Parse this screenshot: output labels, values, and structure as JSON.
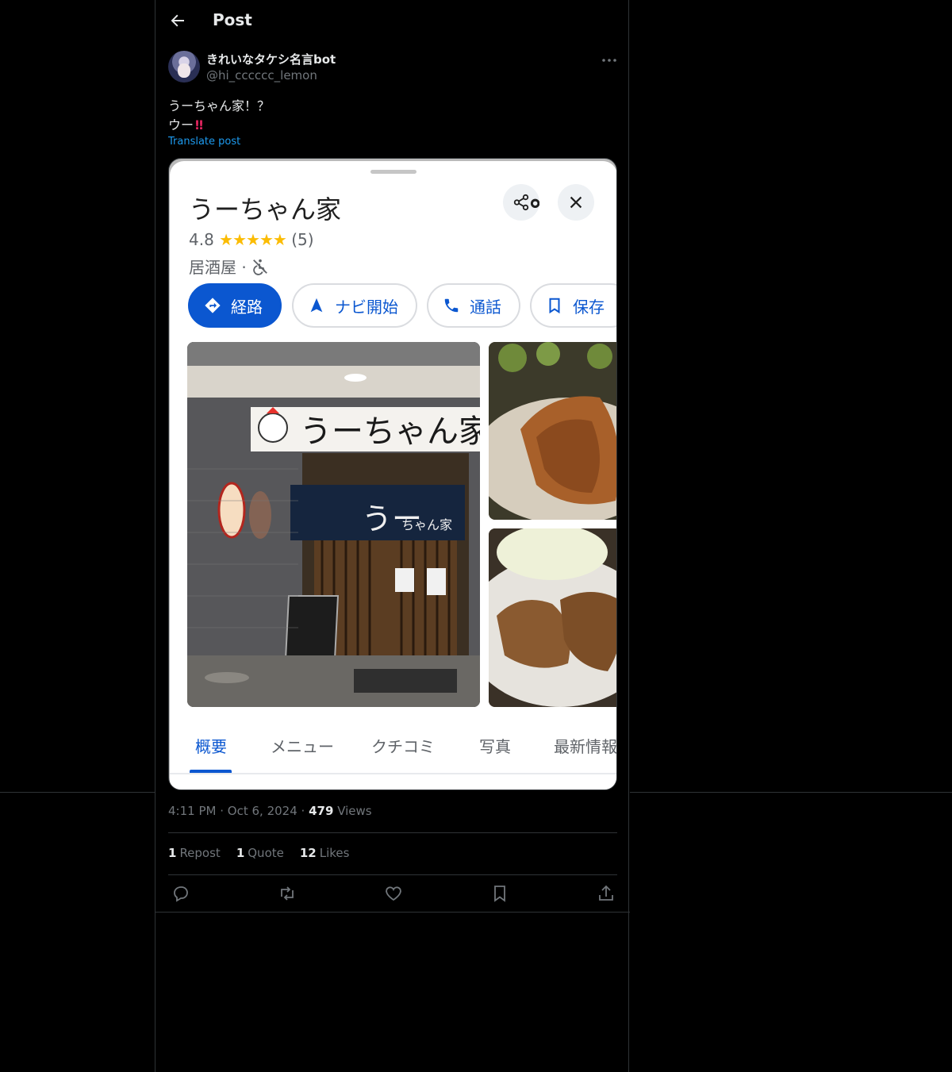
{
  "header": {
    "title": "Post"
  },
  "author": {
    "name": "きれいなタケシ名言bot",
    "handle": "@hi_cccccc_lemon"
  },
  "post": {
    "line1": "うーちゃん家！？",
    "line2": "ウー",
    "emoji": "‼",
    "translate_label": "Translate post"
  },
  "screenshot": {
    "place_name": "うーちゃん家",
    "rating": "4.8",
    "stars": "★★★★★",
    "review_count": "(5)",
    "category": "居酒屋 · ",
    "buttons": [
      "経路",
      "ナビ開始",
      "通話",
      "保存"
    ],
    "tabs": [
      "概要",
      "メニュー",
      "クチコミ",
      "写真",
      "最新情報"
    ],
    "sign_text": "うーちゃん家",
    "noren_text": "うー",
    "noren_small": "ちゃん家"
  },
  "meta": {
    "time": "4:11 PM",
    "sep": "·",
    "date": "Oct 6, 2024",
    "views_count": "479",
    "views_label": "Views"
  },
  "stats": {
    "reposts": "1",
    "reposts_label": "Repost",
    "quotes": "1",
    "quotes_label": "Quote",
    "likes": "12",
    "likes_label": "Likes"
  },
  "colors": {
    "accent": "#1d9bf0",
    "maps_blue": "#0b57d0",
    "star": "#fbbc04"
  }
}
